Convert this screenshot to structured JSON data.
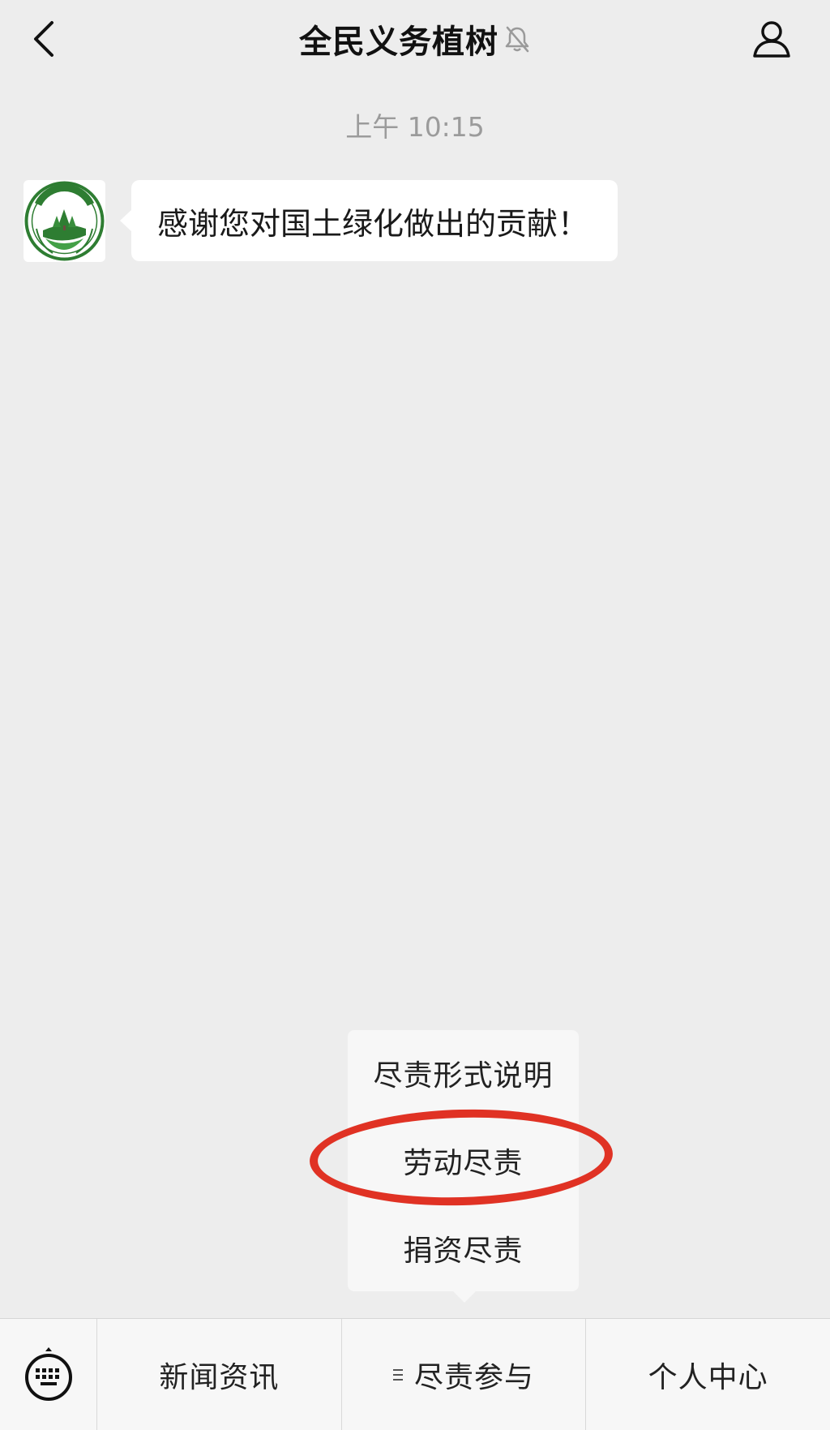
{
  "header": {
    "title": "全民义务植树",
    "back_icon": "chevron-left-icon",
    "mute_icon": "bell-muted-icon",
    "profile_icon": "user-icon"
  },
  "chat": {
    "timestamp": "上午 10:15",
    "messages": [
      {
        "sender_avatar": "全民义务植树",
        "text": "感谢您对国土绿化做出的贡献！"
      }
    ]
  },
  "submenu": {
    "items": [
      {
        "label": "尽责形式说明"
      },
      {
        "label": "劳动尽责"
      },
      {
        "label": "捐资尽责"
      }
    ],
    "highlighted_index": 1,
    "highlight_color": "#e03224"
  },
  "bottom_menu": {
    "keyboard_icon": "keyboard-icon",
    "tabs": [
      {
        "label": "新闻资讯"
      },
      {
        "label": "尽责参与",
        "icon": "menu-list-icon"
      },
      {
        "label": "个人中心"
      }
    ]
  },
  "colors": {
    "background": "#ededed",
    "bubble": "#ffffff",
    "logo_green": "#2e7d32"
  }
}
